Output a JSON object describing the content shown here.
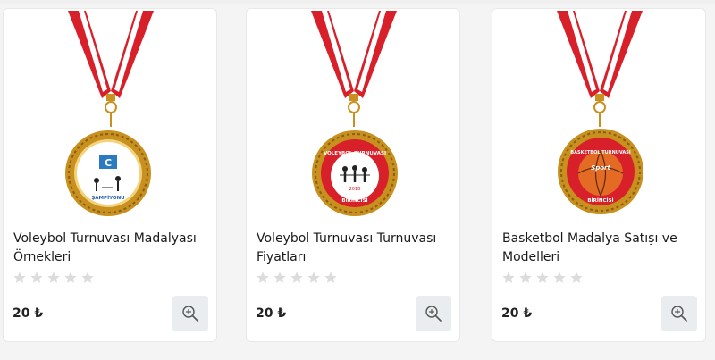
{
  "products": [
    {
      "title": "Voleybol Turnuvası Madalyası Örnekleri",
      "price": "20 ₺",
      "rating": 0,
      "image_icon": "volleyball-championship-medal-icon",
      "medal_text": "ŞAMPİYONU"
    },
    {
      "title": "Voleybol Turnuvası Turnuvası Fiyatları",
      "price": "20 ₺",
      "rating": 0,
      "image_icon": "volleyball-tournament-medal-icon",
      "medal_text": "VOLEYBOL TURNUVASI",
      "medal_year": "2018",
      "medal_place": "BİRİNCİSİ"
    },
    {
      "title": "Basketbol Madalya Satışı ve Modelleri",
      "price": "20 ₺",
      "rating": 0,
      "image_icon": "basketball-tournament-medal-icon",
      "medal_text": "BASKETBOL TURNUVASI",
      "medal_logo": "Sport",
      "medal_place": "BİRİNCİSİ"
    }
  ],
  "colors": {
    "ribbon_red": "#d8202a",
    "gold": "#c8901e",
    "zoom_button_bg": "#e9edf0",
    "star_empty": "#dcdcdc"
  }
}
